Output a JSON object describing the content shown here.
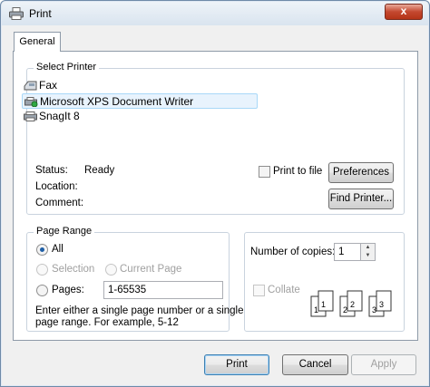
{
  "window": {
    "title": "Print",
    "close_glyph": "x"
  },
  "tabs": [
    {
      "label": "General"
    }
  ],
  "select_printer": {
    "group_label": "Select Printer",
    "printers": [
      {
        "label": "Fax",
        "icon": "fax-icon"
      },
      {
        "label": "Microsoft XPS Document Writer",
        "icon": "printer-default-icon",
        "selected": true
      },
      {
        "label": "SnagIt 8",
        "icon": "printer-icon"
      }
    ],
    "status_label": "Status:",
    "status_value": "Ready",
    "location_label": "Location:",
    "comment_label": "Comment:",
    "print_to_file_label": "Print to file",
    "print_to_file_checked": false,
    "preferences_button": "Preferences",
    "find_printer_button": "Find Printer..."
  },
  "page_range": {
    "group_label": "Page Range",
    "all_label": "All",
    "selection_label": "Selection",
    "current_page_label": "Current Page",
    "pages_label": "Pages:",
    "pages_value": "1-65535",
    "hint_line1": "Enter either a single page number or a single",
    "hint_line2": "page range.  For example, 5-12",
    "selected_option": "All"
  },
  "copies": {
    "label": "Number of copies:",
    "value": "1",
    "collate_label": "Collate",
    "collate_checked": false,
    "collate_pages": [
      "1",
      "1",
      "2",
      "2",
      "3",
      "3"
    ]
  },
  "footer": {
    "print_button": "Print",
    "cancel_button": "Cancel",
    "apply_button": "Apply"
  }
}
